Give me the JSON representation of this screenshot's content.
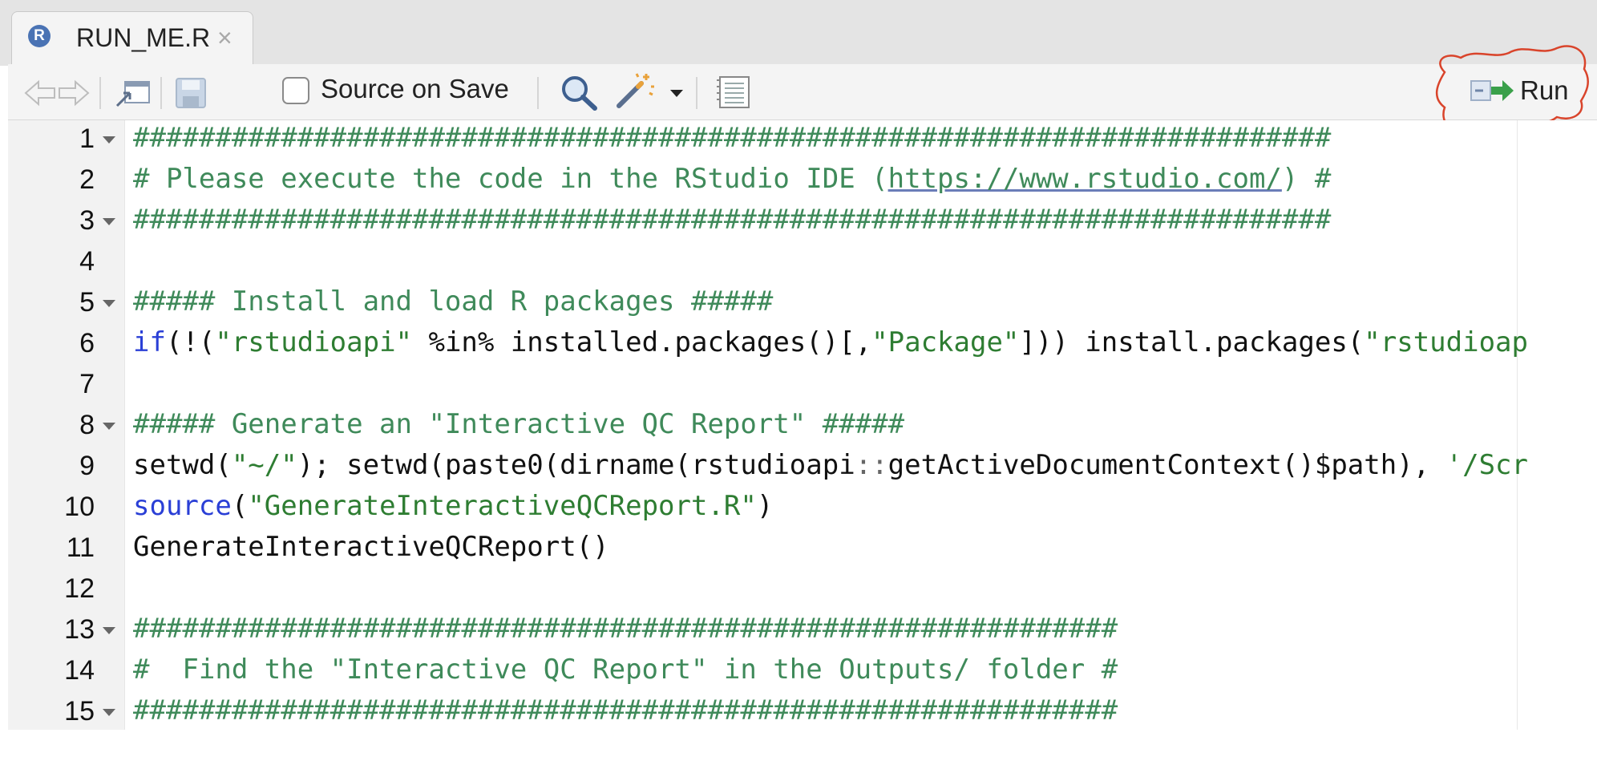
{
  "tab": {
    "title": "RUN_ME.R",
    "close_glyph": "×",
    "r_glyph": "R"
  },
  "toolbar": {
    "source_on_save_label": "Source on Save",
    "source_on_save_checked": false,
    "run_label": "Run"
  },
  "icons": [
    "back-arrow-icon",
    "forward-arrow-icon",
    "show-in-window-icon",
    "save-icon",
    "search-icon",
    "magic-wand-icon",
    "dropdown-caret-icon",
    "notebook-icon",
    "run-icon"
  ],
  "editor": {
    "line_numbers": [
      "1",
      "2",
      "3",
      "4",
      "5",
      "6",
      "7",
      "8",
      "9",
      "10",
      "11",
      "12",
      "13",
      "14",
      "15"
    ],
    "foldable_lines": [
      1,
      3,
      5,
      8,
      13,
      15
    ],
    "lines": [
      "#########################################################################",
      "# Please execute the code in the RStudio IDE (https://www.rstudio.com/) #",
      "#########################################################################",
      "",
      "##### Install and load R packages #####",
      "if(!(\"rstudioapi\" %in% installed.packages()[,\"Package\"])) install.packages(\"rstudioap",
      "",
      "##### Generate an \"Interactive QC Report\" #####",
      "setwd(\"~/\"); setwd(paste0(dirname(rstudioapi::getActiveDocumentContext()$path), '/Scr",
      "source(\"GenerateInteractiveQCReport.R\")",
      "GenerateInteractiveQCReport()",
      "",
      "############################################################",
      "#  Find the \"Interactive QC Report\" in the Outputs/ folder #",
      "############################################################"
    ],
    "segments": {
      "l2_a": "# Please execute the code in the RStudio IDE (",
      "l2_url": "https://www.rstudio.com/",
      "l2_b": ") #",
      "l6_kw": "if",
      "l6_a": "(!(",
      "l6_s1": "\"rstudioapi\"",
      "l6_b": " %in% installed.packages()[,",
      "l6_s2": "\"Package\"",
      "l6_c": "])) install.packages(",
      "l6_s3": "\"rstudioap",
      "l9_a": "setwd(",
      "l9_s1": "\"~/\"",
      "l9_b": "); setwd(paste0(dirname(rstudioapi",
      "l9_op": "::",
      "l9_c": "getActiveDocumentContext()$path), ",
      "l9_s2": "'/Scr",
      "l10_kw": "source",
      "l10_a": "(",
      "l10_s": "\"GenerateInteractiveQCReport.R\"",
      "l10_b": ")"
    }
  },
  "colors": {
    "comment": "#3f8a5a",
    "string": "#2e7d32",
    "keyword": "#2a3fd6",
    "annotation": "#d9442b"
  }
}
